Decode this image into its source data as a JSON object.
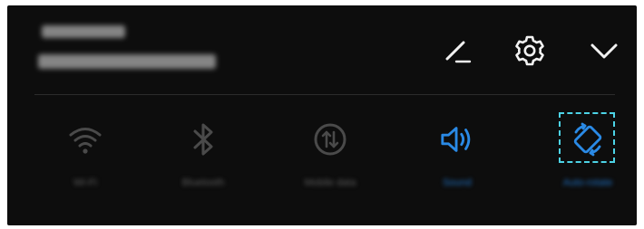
{
  "header": {
    "line1": "Thu 20:54",
    "line2": "Tuesday 15 December",
    "icons": [
      "edit-icon",
      "settings-icon",
      "chevron-down-icon"
    ]
  },
  "tiles": [
    {
      "label": "Wi-Fi",
      "icon": "wifi-icon",
      "active": false
    },
    {
      "label": "Bluetooth",
      "icon": "bluetooth-icon",
      "active": false
    },
    {
      "label": "Mobile data",
      "icon": "mobile-data-icon",
      "active": false
    },
    {
      "label": "Sound",
      "icon": "sound-icon",
      "active": true
    },
    {
      "label": "Auto-rotate",
      "icon": "auto-rotate-icon",
      "active": true
    }
  ],
  "colors": {
    "background": "#0d0d0d",
    "inactive_icon": "#4a4a4a",
    "active_icon": "#2a8ae6",
    "highlight": "#4cd3e6",
    "header_icon": "#f2f2f2"
  }
}
